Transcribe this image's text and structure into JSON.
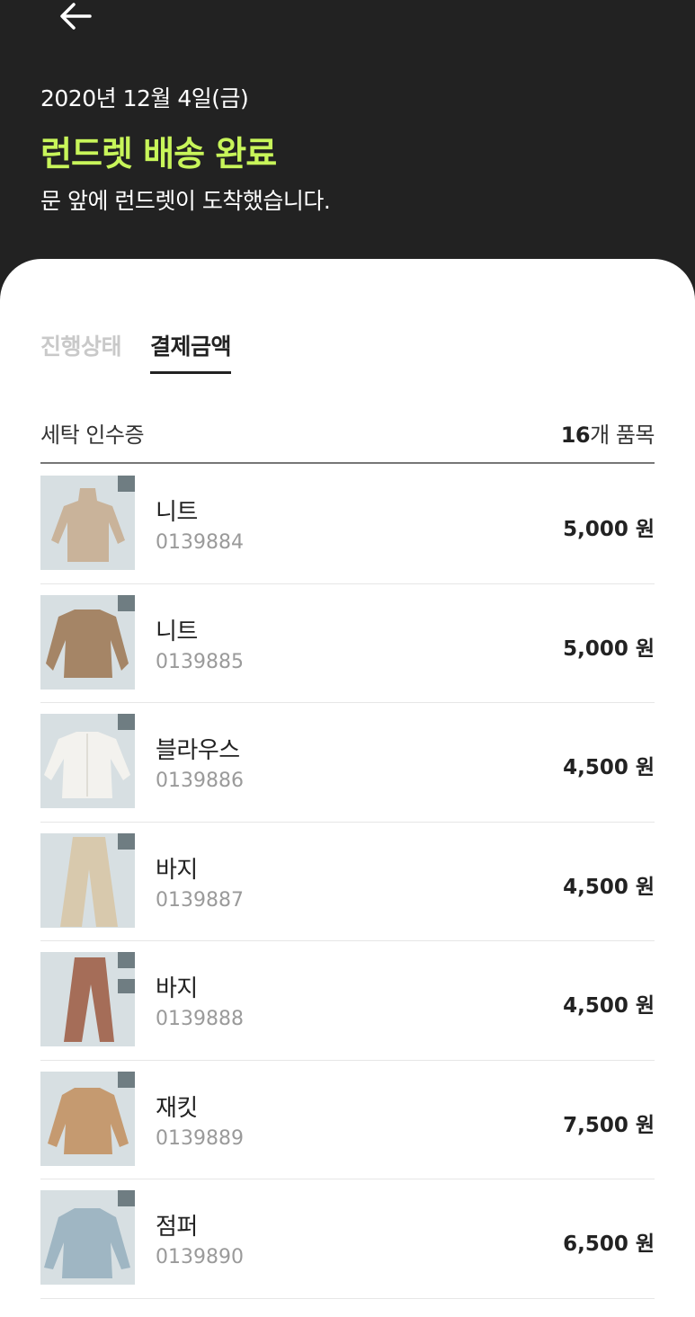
{
  "header": {
    "date": "2020년 12월 4일(금)",
    "title": "런드렛 배송 완료",
    "subtitle": "문 앞에 런드렛이 도착했습니다.",
    "back_icon": "arrow-left-icon"
  },
  "colors": {
    "header_bg": "#222222",
    "accent": "#c8f55a"
  },
  "tabs": [
    {
      "label": "진행상태",
      "active": false
    },
    {
      "label": "결제금액",
      "active": true
    }
  ],
  "receipt": {
    "label": "세탁 인수증",
    "count": "16",
    "count_suffix": "개 품목"
  },
  "items": [
    {
      "name": "니트",
      "code": "0139884",
      "price": "5,000 원",
      "image": "beige-turtleneck-knit"
    },
    {
      "name": "니트",
      "code": "0139885",
      "price": "5,000 원",
      "image": "brown-knit-top"
    },
    {
      "name": "블라우스",
      "code": "0139886",
      "price": "4,500 원",
      "image": "white-blouse"
    },
    {
      "name": "바지",
      "code": "0139887",
      "price": "4,500 원",
      "image": "beige-pants"
    },
    {
      "name": "바지",
      "code": "0139888",
      "price": "4,500 원",
      "image": "rust-pants"
    },
    {
      "name": "재킷",
      "code": "0139889",
      "price": "7,500 원",
      "image": "camel-jacket"
    },
    {
      "name": "점퍼",
      "code": "0139890",
      "price": "6,500 원",
      "image": "light-blue-jumper"
    }
  ]
}
